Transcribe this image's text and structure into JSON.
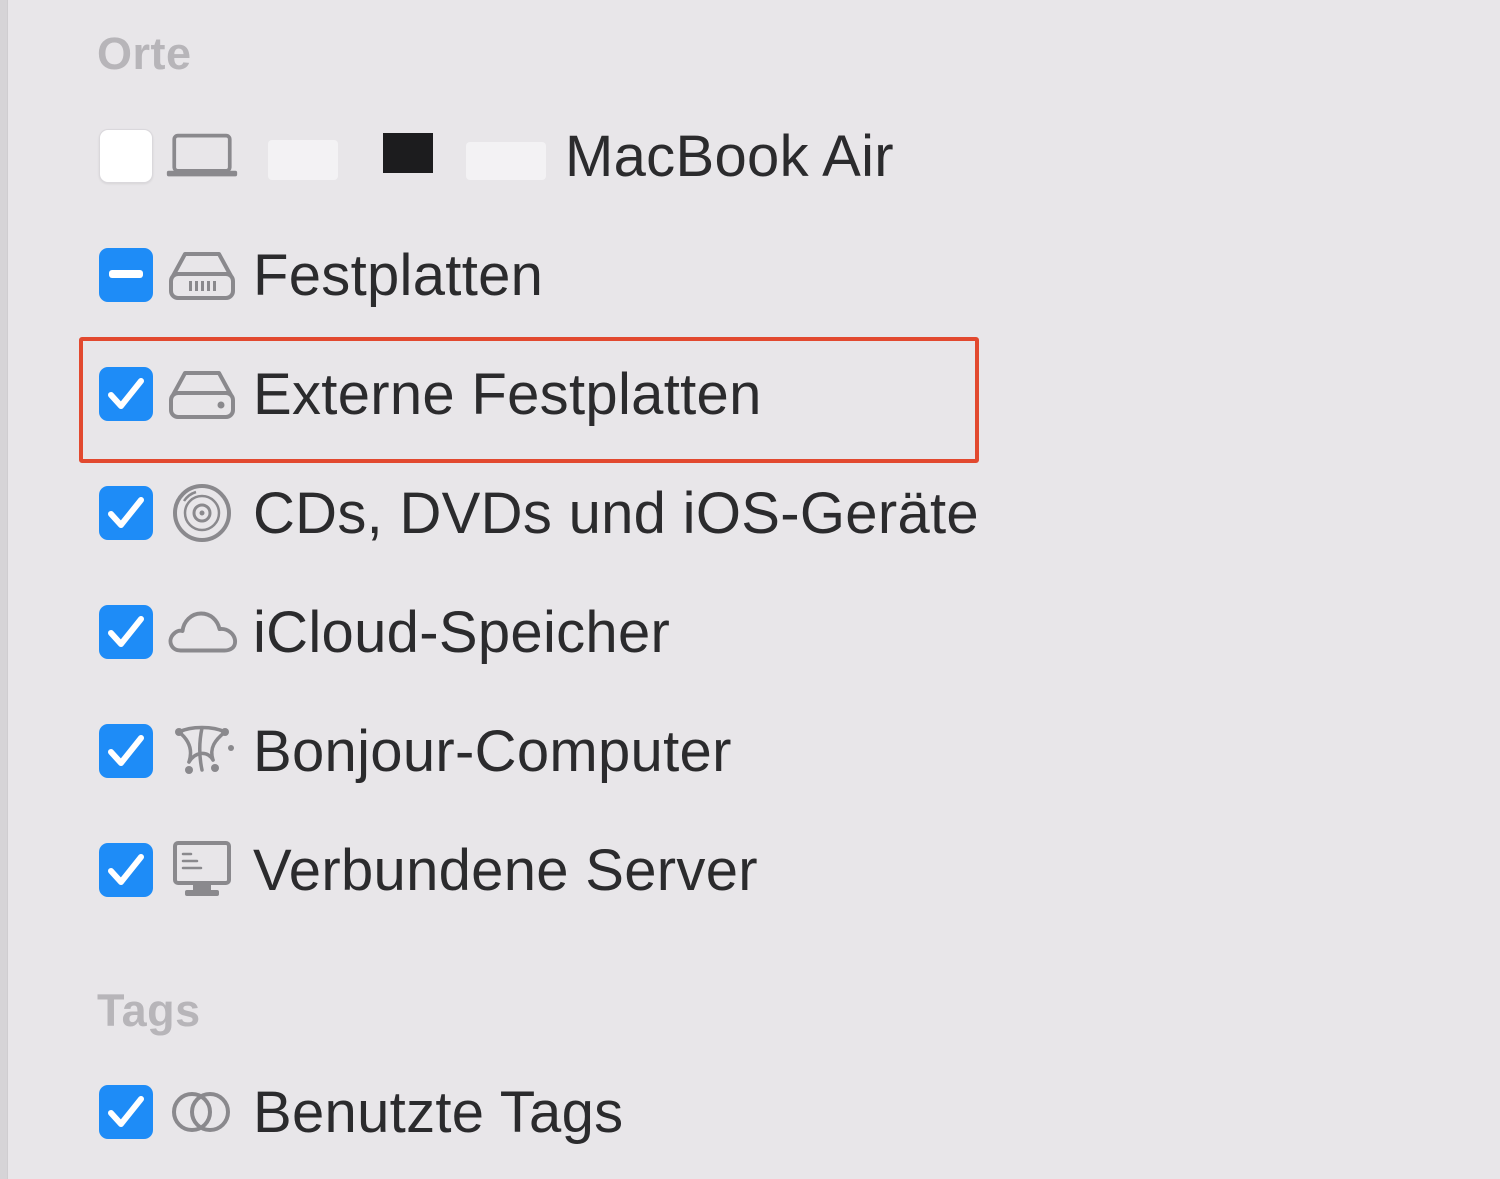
{
  "sections": {
    "places": {
      "header": "Orte",
      "items": [
        {
          "label": "MacBook Air",
          "checked": "off",
          "icon": "laptop-icon"
        },
        {
          "label": "Festplatten",
          "checked": "mixed",
          "icon": "internal-drive-icon"
        },
        {
          "label": "Externe Festplatten",
          "checked": "on",
          "icon": "external-drive-icon"
        },
        {
          "label": "CDs, DVDs und iOS-Geräte",
          "checked": "on",
          "icon": "disc-icon"
        },
        {
          "label": "iCloud-Speicher",
          "checked": "on",
          "icon": "cloud-icon"
        },
        {
          "label": "Bonjour-Computer",
          "checked": "on",
          "icon": "bonjour-icon"
        },
        {
          "label": "Verbundene Server",
          "checked": "on",
          "icon": "server-icon"
        }
      ]
    },
    "tags": {
      "header": "Tags",
      "items": [
        {
          "label": "Benutzte Tags",
          "checked": "on",
          "icon": "tags-icon"
        }
      ]
    }
  },
  "colors": {
    "background": "#e8e6e9",
    "checkbox_blue": "#1e8cf7",
    "highlight_red": "#e2492f",
    "header_gray": "#b7b5b9"
  }
}
